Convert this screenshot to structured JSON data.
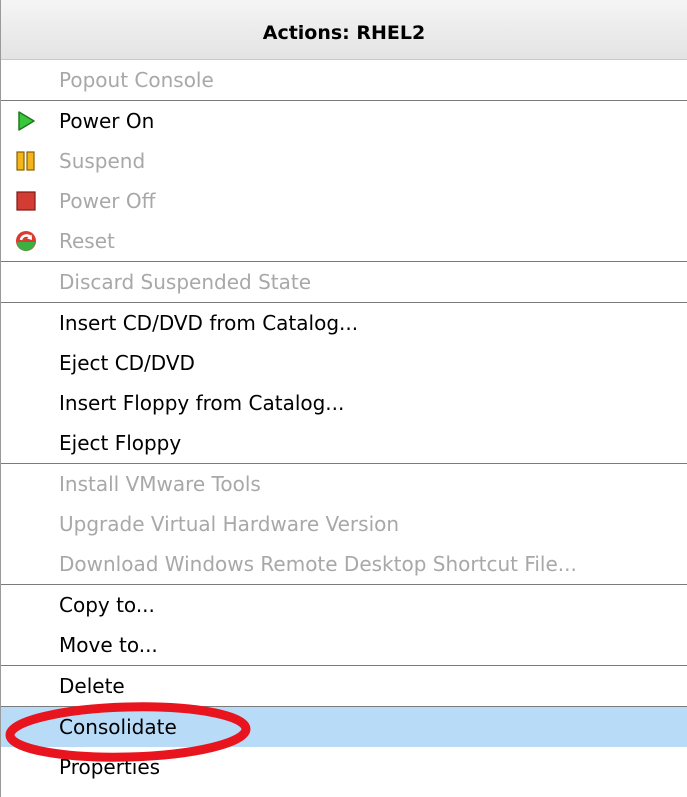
{
  "menu": {
    "title": "Actions: RHEL2",
    "groups": [
      [
        {
          "label": "Popout Console",
          "disabled": true
        }
      ],
      [
        {
          "label": "Power On",
          "icon": "play-icon",
          "disabled": false
        },
        {
          "label": "Suspend",
          "icon": "pause-icon",
          "disabled": true
        },
        {
          "label": "Power Off",
          "icon": "stop-icon",
          "disabled": true
        },
        {
          "label": "Reset",
          "icon": "reset-icon",
          "disabled": true
        }
      ],
      [
        {
          "label": "Discard Suspended State",
          "disabled": true
        }
      ],
      [
        {
          "label": "Insert CD/DVD from Catalog...",
          "disabled": false
        },
        {
          "label": "Eject CD/DVD",
          "disabled": false
        },
        {
          "label": "Insert Floppy from Catalog...",
          "disabled": false
        },
        {
          "label": "Eject Floppy",
          "disabled": false
        }
      ],
      [
        {
          "label": "Install VMware Tools",
          "disabled": true
        },
        {
          "label": "Upgrade Virtual Hardware Version",
          "disabled": true
        },
        {
          "label": "Download Windows Remote Desktop Shortcut File...",
          "disabled": true
        }
      ],
      [
        {
          "label": "Copy to...",
          "disabled": false
        },
        {
          "label": "Move to...",
          "disabled": false
        }
      ],
      [
        {
          "label": "Delete",
          "disabled": false
        }
      ],
      [
        {
          "label": "Consolidate",
          "disabled": false,
          "highlighted": true
        },
        {
          "label": "Properties",
          "disabled": false
        }
      ]
    ]
  },
  "colors": {
    "highlight": "#b8dcf8",
    "disabled_text": "#a8a8a8",
    "annotation": "#e8141e",
    "play_icon": "#3cc63c",
    "pause_icon": "#f2b51a",
    "stop_icon": "#d23c32"
  }
}
